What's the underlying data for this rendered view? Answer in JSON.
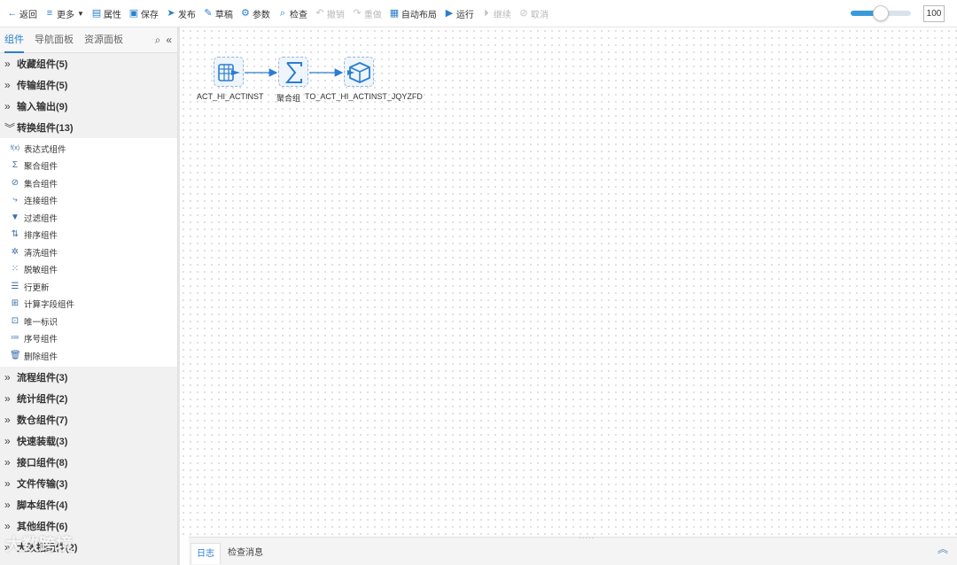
{
  "toolbar": {
    "back": "返回",
    "more": "更多",
    "properties": "属性",
    "save": "保存",
    "publish": "发布",
    "draft": "草稿",
    "params": "参数",
    "check": "检查",
    "undo": "撤销",
    "redo": "重做",
    "auto_layout": "自动布局",
    "run": "运行",
    "continue": "继续",
    "cancel": "取消",
    "zoom_value": "100",
    "zoom_level": 0.5
  },
  "sidebar": {
    "tabs": [
      "组件",
      "导航面板",
      "资源面板"
    ],
    "categories_top": [
      "收藏组件(5)",
      "传输组件(5)",
      "输入输出(9)",
      "转换组件(13)"
    ],
    "transform_items": [
      "表达式组件",
      "聚合组件",
      "集合组件",
      "连接组件",
      "过滤组件",
      "排序组件",
      "清洗组件",
      "脱敏组件",
      "行更新",
      "计算字段组件",
      "唯一标识",
      "序号组件",
      "删除组件"
    ],
    "categories_bottom": [
      "流程组件(3)",
      "统计组件(2)",
      "数仓组件(7)",
      "快速装载(3)",
      "接口组件(8)",
      "文件传输(3)",
      "脚本组件(4)",
      "其他组件(6)",
      "大数据组件(2)"
    ]
  },
  "canvas": {
    "nodes": [
      {
        "label": "ACT_HI_ACTINST",
        "icon": "table-input-icon"
      },
      {
        "label": "聚合组",
        "icon": "sigma-icon"
      },
      {
        "label": "TO_ACT_HI_ACTINST_JQYZFD",
        "icon": "cube-output-icon"
      }
    ]
  },
  "bottom": {
    "tabs": [
      "日志",
      "检查消息"
    ]
  },
  "watermark": "大数跨境",
  "colors": {
    "accent": "#2a7ed0",
    "node_bg": "#eef5fc"
  }
}
